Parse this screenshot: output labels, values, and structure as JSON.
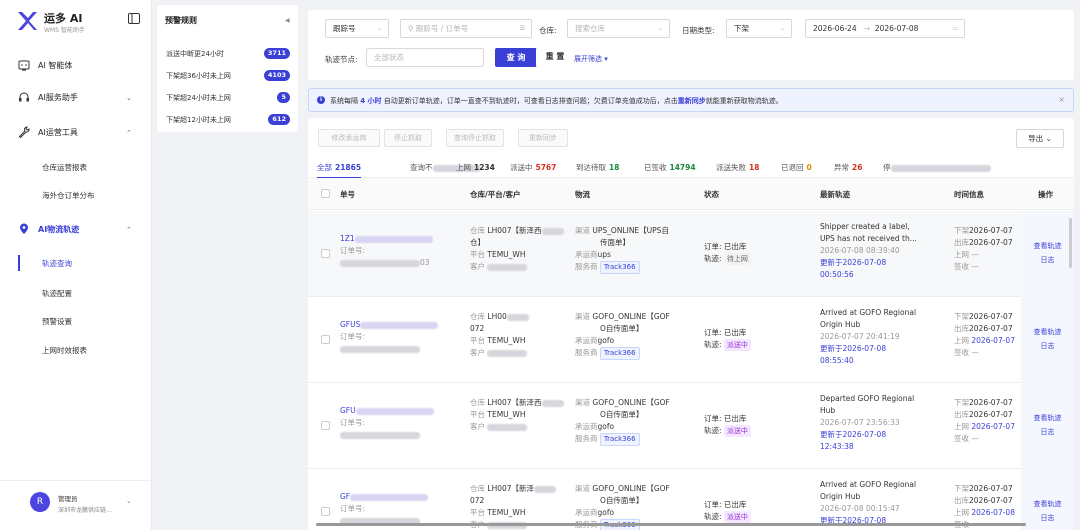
{
  "app": {
    "name": "运多 AI",
    "subtitle": "WMS 智能助手"
  },
  "sidebar": {
    "items": [
      {
        "label": "AI 智能体",
        "icon": "robot-icon"
      },
      {
        "label": "AI服务助手",
        "icon": "headset-icon"
      },
      {
        "label": "AI运营工具",
        "icon": "wrench-icon"
      },
      {
        "label": "AI物流轨迹",
        "icon": "location-pin-icon"
      }
    ],
    "ops_sub": [
      "仓库运营报表",
      "海外仓订单分布"
    ],
    "track_sub": [
      "轨迹查询",
      "轨迹配置",
      "预警设置",
      "上网时效报表"
    ]
  },
  "user": {
    "name": "管理员",
    "org": "深圳市龙騰供应链...",
    "avatar": "R"
  },
  "rules": {
    "title": "预警规则",
    "items": [
      {
        "label": "派送中断更24小时",
        "count": "3711"
      },
      {
        "label": "下架超36小时未上网",
        "count": "4103"
      },
      {
        "label": "下架超24小时未上网",
        "count": "5"
      },
      {
        "label": "下架超12小时未上网",
        "count": "612"
      }
    ]
  },
  "filters": {
    "track_type": "跟踪号",
    "search_placeholder": "跟踪号 / 订单号",
    "warehouse_label": "仓库:",
    "warehouse_placeholder": "搜索仓库",
    "date_type_label": "日期类型:",
    "date_type": "下架",
    "date_from": "2026-06-24",
    "date_sep": "→",
    "date_to": "2026-07-08",
    "node_label": "轨迹节点:",
    "node_placeholder": "全部状态",
    "query": "查 询",
    "reset": "重 置",
    "expand": "展开筛选"
  },
  "info": {
    "prefix": "系统每隔",
    "interval": "4 小时",
    "middle": "自动更新订单轨迹，订单一直查不到轨迹时，可查看日志排查问题；欠费订单充值成功后，点击",
    "link": "重新同步",
    "suffix": "就能重新获取物流轨迹。"
  },
  "toolbar": {
    "buttons": [
      "修改承运商",
      "停止抓取",
      "查询停止抓取",
      "重新同步"
    ],
    "export": "导出"
  },
  "tabs": [
    {
      "label": "全部",
      "count": "21865",
      "color": "#3a3fd6"
    },
    {
      "label": "查询不",
      "count": "",
      "color": "#333"
    },
    {
      "label": "上网",
      "count": "1234",
      "color": "#333"
    },
    {
      "label": "派送中",
      "count": "5767",
      "color": "#d6311f"
    },
    {
      "label": "到达待取",
      "count": "18",
      "color": "#1a8a3c"
    },
    {
      "label": "已签收",
      "count": "14794",
      "color": "#1a8a3c"
    },
    {
      "label": "派送失败",
      "count": "18",
      "color": "#d6311f"
    },
    {
      "label": "已退回",
      "count": "0",
      "color": "#e08a00"
    },
    {
      "label": "异常",
      "count": "26",
      "color": "#d6311f"
    },
    {
      "label": "停",
      "count": "",
      "color": "#333"
    }
  ],
  "columns": [
    "单号",
    "仓库/平台/客户",
    "物流",
    "状态",
    "最新轨迹",
    "时间信息",
    "操作"
  ],
  "labels": {
    "order_no": "订单号:",
    "warehouse": "仓库",
    "platform": "平台",
    "customer": "客户",
    "channel": "渠道",
    "carrier": "承运商",
    "provider": "服务商",
    "order_status": "订单:",
    "track_status": "轨迹:",
    "updated": "更新于",
    "pickup": "下架",
    "outbound": "出库",
    "online": "上网",
    "signed": "签收",
    "view": "查看轨迹",
    "log": "日志"
  },
  "rows": [
    {
      "id": "1Z1",
      "id_tail": "03",
      "warehouse": "LH007【新泽西",
      "warehouse2": "仓】",
      "platform": "TEMU_WH",
      "customer": "",
      "channel": "UPS_ONLINE【UPS自",
      "channel2": "传面单】",
      "carrier": "ups",
      "provider": "Track366",
      "order": "已出库",
      "track": "待上网",
      "track_style": "gray",
      "latest": "Shipper created a label,",
      "latest2": "UPS has not received th...",
      "latest_time": "2026-07-08 08:39:40",
      "updated": "2026-07-08",
      "updated2": "00:50:56",
      "t_pick": "2026-07-07",
      "t_out": "2026-07-07",
      "t_online": "—",
      "t_sign": "—"
    },
    {
      "id": "GFUS",
      "id_tail": "",
      "warehouse": "LH00",
      "warehouse2": "072",
      "platform": "TEMU_WH",
      "customer": "",
      "channel": "GOFO_ONLINE【GOF",
      "channel2": "O自传面单】",
      "carrier": "gofo",
      "provider": "Track366",
      "order": "已出库",
      "track": "派送中",
      "track_style": "purple",
      "latest": "Arrived at GOFO Regional",
      "latest2": "Origin Hub",
      "latest_time": "2026-07-07 20:41:19",
      "updated": "2026-07-08",
      "updated2": "08:55:40",
      "t_pick": "2026-07-07",
      "t_out": "2026-07-07",
      "t_online": "2026-07-07",
      "t_sign": "—"
    },
    {
      "id": "GFU",
      "id_tail": "",
      "warehouse": "LH007【新泽西",
      "warehouse2": "",
      "platform": "TEMU_WH",
      "customer": "",
      "channel": "GOFO_ONLINE【GOF",
      "channel2": "O自传面单】",
      "carrier": "gofo",
      "provider": "Track366",
      "order": "已出库",
      "track": "派送中",
      "track_style": "purple",
      "latest": "Departed GOFO Regional",
      "latest2": "Hub",
      "latest_time": "2026-07-07 23:56:33",
      "updated": "2026-07-08",
      "updated2": "12:43:38",
      "t_pick": "2026-07-07",
      "t_out": "2026-07-07",
      "t_online": "2026-07-07",
      "t_sign": "—"
    },
    {
      "id": "GF",
      "id_tail": "",
      "warehouse": "LH007【新泽",
      "warehouse2": "072",
      "platform": "TEMU_WH",
      "customer": "",
      "channel": "GOFO_ONLINE【GOF",
      "channel2": "O自传面单】",
      "carrier": "gofo",
      "provider": "Track366",
      "order": "已出库",
      "track": "派送中",
      "track_style": "purple",
      "latest": "Arrived at GOFO Regional",
      "latest2": "Origin Hub",
      "latest_time": "2026-07-08 00:15:47",
      "updated": "2026-07-08",
      "updated2": "",
      "t_pick": "2026-07-07",
      "t_out": "2026-07-07",
      "t_online": "2026-07-08",
      "t_sign": ""
    }
  ]
}
